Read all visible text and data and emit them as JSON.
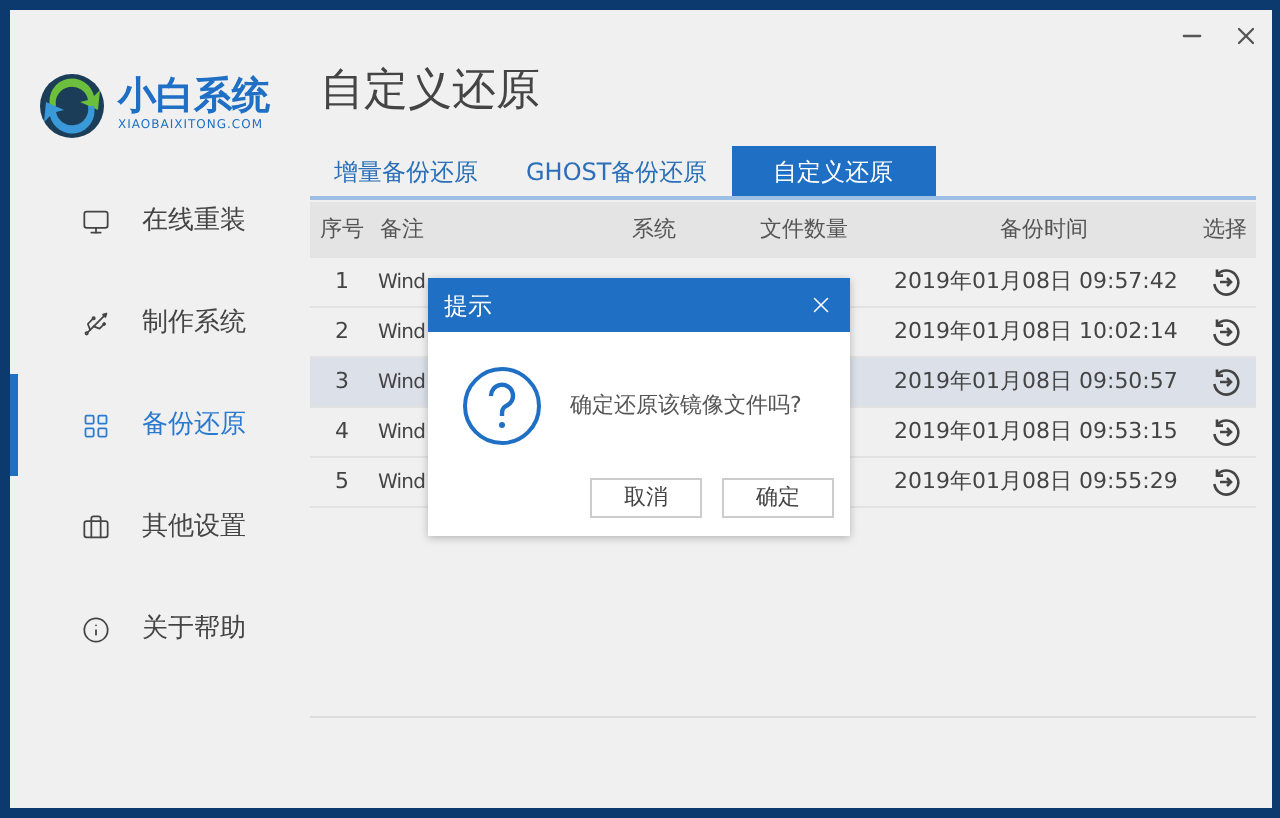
{
  "logo": {
    "name": "小白系统",
    "domain": "XIAOBAIXITONG.COM"
  },
  "sidebar": {
    "items": [
      {
        "label": "在线重装",
        "kind": "monitor",
        "selected": false
      },
      {
        "label": "制作系统",
        "kind": "usb",
        "selected": false
      },
      {
        "label": "备份还原",
        "kind": "grid",
        "selected": true
      },
      {
        "label": "其他设置",
        "kind": "briefcase",
        "selected": false
      },
      {
        "label": "关于帮助",
        "kind": "info",
        "selected": false
      }
    ]
  },
  "page_title": "自定义还原",
  "tabs": [
    {
      "label": "增量备份还原",
      "selected": false
    },
    {
      "label": "GHOST备份还原",
      "selected": false
    },
    {
      "label": "自定义还原",
      "selected": true
    }
  ],
  "table": {
    "columns": [
      "序号",
      "备注",
      "系统",
      "文件数量",
      "备份时间",
      "选择"
    ],
    "rows": [
      {
        "index": "1",
        "note": "Wind",
        "time": "2019年01月08日 09:57:42",
        "selected": false
      },
      {
        "index": "2",
        "note": "Wind",
        "time": "2019年01月08日 10:02:14",
        "selected": false
      },
      {
        "index": "3",
        "note": "Wind",
        "time": "2019年01月08日 09:50:57",
        "selected": true
      },
      {
        "index": "4",
        "note": "Wind",
        "time": "2019年01月08日 09:53:15",
        "selected": false
      },
      {
        "index": "5",
        "note": "Wind",
        "time": "2019年01月08日 09:55:29",
        "selected": false
      }
    ]
  },
  "dialog": {
    "title": "提示",
    "message": "确定还原该镜像文件吗?",
    "buttons": [
      "取消",
      "确定"
    ]
  }
}
